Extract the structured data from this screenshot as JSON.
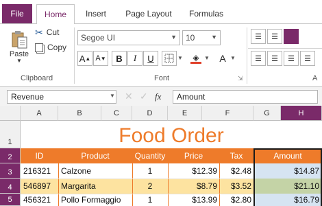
{
  "tabs": {
    "file": "File",
    "home": "Home",
    "insert": "Insert",
    "page_layout": "Page Layout",
    "formulas": "Formulas"
  },
  "clipboard": {
    "paste": "Paste",
    "cut": "Cut",
    "copy": "Copy",
    "group_label": "Clipboard"
  },
  "font": {
    "family": "Segoe UI",
    "size": "10",
    "group_label": "Font",
    "grow": "A",
    "shrink": "A",
    "bold": "B",
    "italic": "I",
    "underline": "U",
    "font_color_glyph": "A",
    "font_color": "#e0402a",
    "fill_color": "#f0a030"
  },
  "alignment": {
    "group_label": "A",
    "swatch_color": "#7a2a69"
  },
  "formula_bar": {
    "name_box": "Revenue",
    "fx": "fx",
    "value": "Amount"
  },
  "columns": [
    "A",
    "B",
    "C",
    "D",
    "E",
    "F",
    "G",
    "H"
  ],
  "rows": [
    "1",
    "2",
    "3",
    "4",
    "5"
  ],
  "sheet": {
    "title": "Food Order",
    "headers": [
      "ID",
      "Product",
      "Quantity",
      "Price",
      "Tax",
      "Amount"
    ],
    "data": [
      {
        "id": "216321",
        "product": "Calzone",
        "qty": "1",
        "price": "$12.39",
        "tax": "$2.48",
        "amount": "$14.87"
      },
      {
        "id": "546897",
        "product": "Margarita",
        "qty": "2",
        "price": "$8.79",
        "tax": "$3.52",
        "amount": "$21.10"
      },
      {
        "id": "456321",
        "product": "Pollo Formaggio",
        "qty": "1",
        "price": "$13.99",
        "tax": "$2.80",
        "amount": "$16.79"
      }
    ]
  },
  "colors": {
    "accent": "#7a2a69",
    "header_orange": "#ee7b2a",
    "title_orange": "#ee7b2a",
    "band_yellow": "#fde3a0",
    "amount_blue": "#d6e4f2",
    "amount_blue_band": "#c4d3a6"
  }
}
